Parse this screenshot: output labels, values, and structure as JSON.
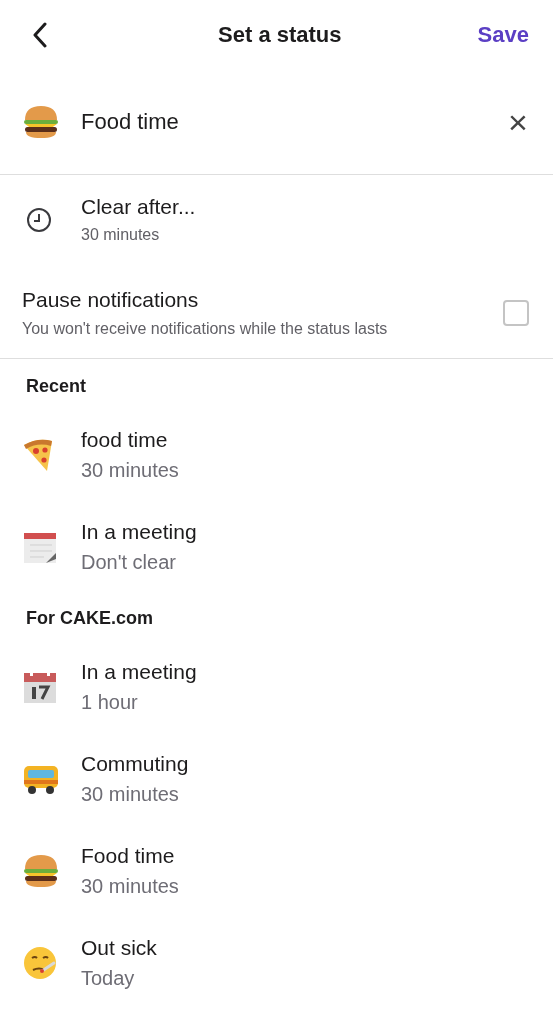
{
  "header": {
    "title": "Set a status",
    "save": "Save"
  },
  "current": {
    "kind": "burger",
    "text": "Food time",
    "clear": "×"
  },
  "clear_after": {
    "label": "Clear after...",
    "value": "30 minutes"
  },
  "pause_notifications": {
    "label": "Pause notifications",
    "hint": "You won't receive notifications while the status lasts",
    "checked": false
  },
  "sections": [
    {
      "title": "Recent",
      "items": [
        {
          "kind": "pizza",
          "text": "food time",
          "duration": "30 minutes"
        },
        {
          "kind": "notepad",
          "text": "In a meeting",
          "duration": "Don't clear"
        }
      ]
    },
    {
      "title": "For CAKE.com",
      "items": [
        {
          "kind": "calendar",
          "text": "In a meeting",
          "duration": "1 hour"
        },
        {
          "kind": "bus",
          "text": "Commuting",
          "duration": "30 minutes"
        },
        {
          "kind": "burger",
          "text": "Food time",
          "duration": "30 minutes"
        },
        {
          "kind": "sick",
          "text": "Out sick",
          "duration": "Today"
        }
      ]
    }
  ]
}
